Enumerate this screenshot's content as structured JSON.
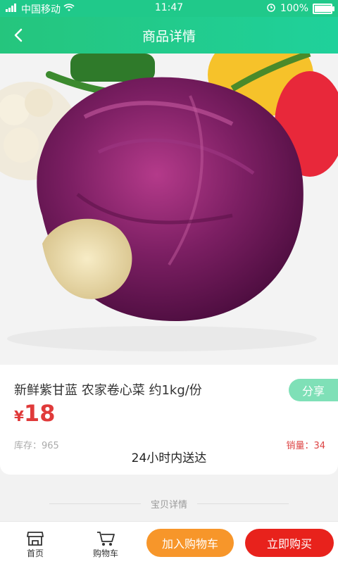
{
  "status": {
    "carrier": "中国移动",
    "time": "11:47",
    "battery": "100%",
    "battery_level": 1.0
  },
  "header": {
    "title": "商品详情"
  },
  "product": {
    "name": "新鲜紫甘蓝 农家卷心菜 约1kg/份",
    "price_symbol": "¥",
    "price": "18",
    "share": "分享",
    "stock_label": "库存：",
    "stock": "965",
    "sales_label": "销量：",
    "sales": "34",
    "delivery": "24小时内送达"
  },
  "details": {
    "label": "宝贝详情"
  },
  "bottom": {
    "home": "首页",
    "cart": "购物车",
    "add_to_cart": "加入购物车",
    "buy_now": "立即购买"
  },
  "colors": {
    "brand": "#20c98a",
    "price": "#e03a3a",
    "orange": "#f7962a",
    "red": "#e8221c"
  }
}
